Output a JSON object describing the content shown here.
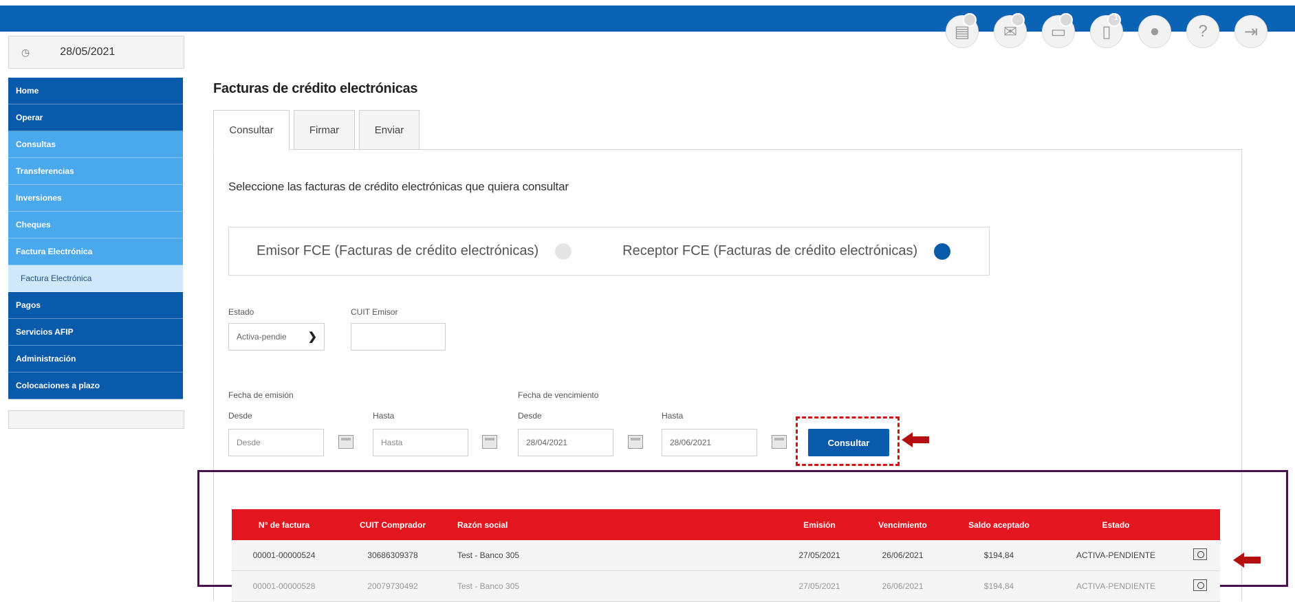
{
  "header": {
    "icons": [
      {
        "name": "document-icon",
        "glyph": "▤",
        "badge": ""
      },
      {
        "name": "mail-icon",
        "glyph": "✉",
        "badge": ""
      },
      {
        "name": "card-icon",
        "glyph": "▭",
        "badge": ""
      },
      {
        "name": "token-icon",
        "glyph": "▯",
        "badge": "1"
      },
      {
        "name": "user-icon",
        "glyph": "●",
        "badge": ""
      },
      {
        "name": "help-icon",
        "glyph": "?",
        "badge": ""
      },
      {
        "name": "logout-icon",
        "glyph": "⇥",
        "badge": ""
      }
    ]
  },
  "date": "28/05/2021",
  "sidebar": {
    "items": [
      {
        "label": "Home",
        "style": "dark"
      },
      {
        "label": "Operar",
        "style": "dark"
      },
      {
        "label": "Consultas",
        "style": "light"
      },
      {
        "label": "Transferencias",
        "style": "light"
      },
      {
        "label": "Inversiones",
        "style": "light"
      },
      {
        "label": "Cheques",
        "style": "light"
      },
      {
        "label": "Factura Electrónica",
        "style": "light"
      },
      {
        "label": "Factura Electrónica",
        "style": "sub"
      },
      {
        "label": "Pagos",
        "style": "dark"
      },
      {
        "label": "Servicios AFIP",
        "style": "dark"
      },
      {
        "label": "Administración",
        "style": "dark"
      },
      {
        "label": "Colocaciones a plazo",
        "style": "dark"
      }
    ]
  },
  "page": {
    "title": "Facturas de crédito electrónicas",
    "tabs": [
      "Consultar",
      "Firmar",
      "Enviar"
    ],
    "instruction": "Seleccione las facturas de crédito electrónicas que quiera consultar"
  },
  "radio": {
    "emisor": "Emisor FCE (Facturas de crédito electrónicas)",
    "receptor": "Receptor FCE (Facturas de crédito electrónicas)",
    "selected": "receptor"
  },
  "filters": {
    "estado_label": "Estado",
    "estado_value": "Activa-pendie",
    "cuit_label": "CUIT Emisor",
    "cuit_value": "",
    "emision_label": "Fecha de emisión",
    "vencimiento_label": "Fecha de vencimiento",
    "desde_label": "Desde",
    "hasta_label": "Hasta",
    "emision_desde_placeholder": "Desde",
    "emision_hasta_placeholder": "Hasta",
    "venc_desde_value": "28/04/2021",
    "venc_hasta_value": "28/06/2021",
    "consultar_label": "Consultar"
  },
  "table": {
    "headers": [
      "N° de factura",
      "CUIT Comprador",
      "Razón social",
      "Emisión",
      "Vencimiento",
      "Saldo aceptado",
      "Estado",
      ""
    ],
    "rows": [
      [
        "00001-00000524",
        "30686309378",
        "Test - Banco 305",
        "27/05/2021",
        "26/06/2021",
        "$194,84",
        "ACTIVA-PENDIENTE"
      ],
      [
        "00001-00000528",
        "20079730492",
        "Test - Banco 305",
        "27/05/2021",
        "26/06/2021",
        "$194,84",
        "ACTIVA-PENDIENTE"
      ]
    ]
  },
  "colors": {
    "topbar": "#0a63b4",
    "sidebar_dark": "#0a5aab",
    "sidebar_light": "#4aa8ed",
    "table_header": "#e3161f",
    "highlight_red": "#d11313",
    "highlight_purple": "#4a0f4f"
  }
}
